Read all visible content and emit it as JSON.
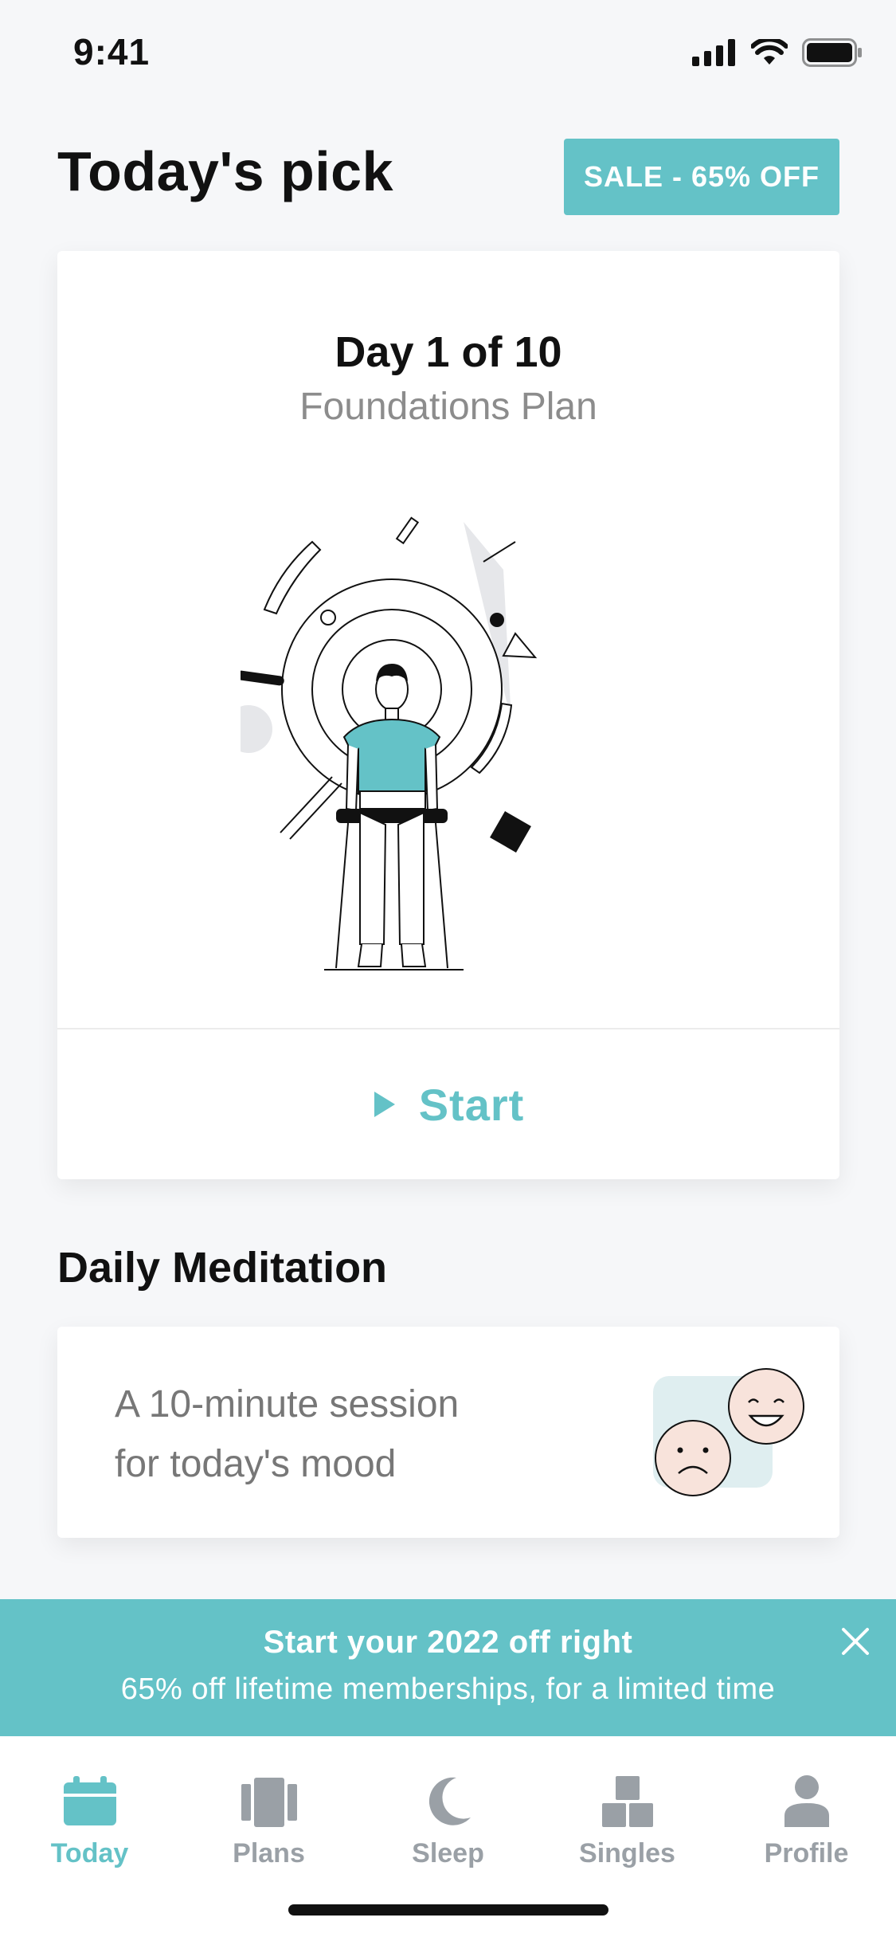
{
  "status_bar": {
    "time": "9:41"
  },
  "header": {
    "title": "Today's pick",
    "sale_badge": "SALE - 65% OFF"
  },
  "pick_card": {
    "day": "Day 1 of 10",
    "plan": "Foundations Plan",
    "start_label": "Start",
    "start_icon": "play-icon"
  },
  "daily_meditation": {
    "section_title": "Daily Meditation",
    "description_line1": "A 10-minute session",
    "description_line2": "for today's mood",
    "art": "mood-faces-icon"
  },
  "promo_banner": {
    "title": "Start your 2022 off right",
    "subtitle": "65% off lifetime memberships, for a limited time",
    "close_icon": "close-icon"
  },
  "tabs": [
    {
      "label": "Today",
      "icon": "calendar-icon",
      "active": true
    },
    {
      "label": "Plans",
      "icon": "plans-icon",
      "active": false
    },
    {
      "label": "Sleep",
      "icon": "moon-icon",
      "active": false
    },
    {
      "label": "Singles",
      "icon": "blocks-icon",
      "active": false
    },
    {
      "label": "Profile",
      "icon": "person-icon",
      "active": false
    }
  ],
  "colors": {
    "accent": "#64c2c7",
    "inactive": "#9aa0a6",
    "background": "#f6f7f9"
  }
}
